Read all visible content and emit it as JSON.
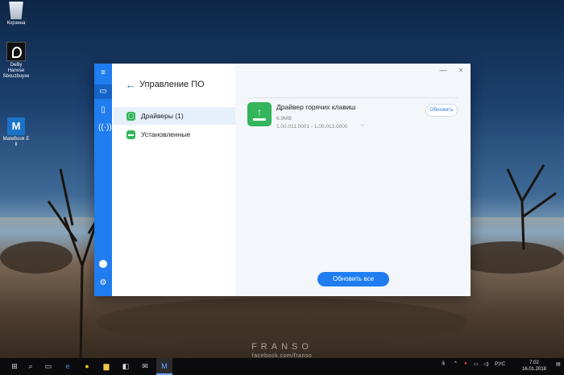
{
  "desktop": {
    "icons": [
      {
        "label": "Корзина"
      },
      {
        "label": "DeBy Hanvse Sbouzbuyxe"
      },
      {
        "label": "MateBook E Il"
      }
    ],
    "watermark": {
      "main": "FRANSO",
      "sub": "facebook.com/franso"
    }
  },
  "window": {
    "title": "Управление ПО",
    "controls": {
      "minimize": "—",
      "close": "×"
    },
    "rail_icons": [
      "menu-icon",
      "laptop-icon",
      "phone-icon",
      "wireless-icon",
      "avatar-icon",
      "gear-icon"
    ],
    "nav": [
      {
        "label": "Драйверы (1)",
        "selected": true
      },
      {
        "label": "Установленные",
        "selected": false
      }
    ],
    "driver": {
      "name": "Драйвер горячих клавиш",
      "size": "6.9MB",
      "version": "1.00.011.0001 - 1.00.013.0000",
      "update_label": "Обновить"
    },
    "update_all_label": "Обновить все"
  },
  "taskbar": {
    "language": "РУС",
    "time": "7:02",
    "date": "16.01.2018"
  },
  "colors": {
    "accent": "#1f7df0",
    "driver_icon": "#33b55c"
  }
}
